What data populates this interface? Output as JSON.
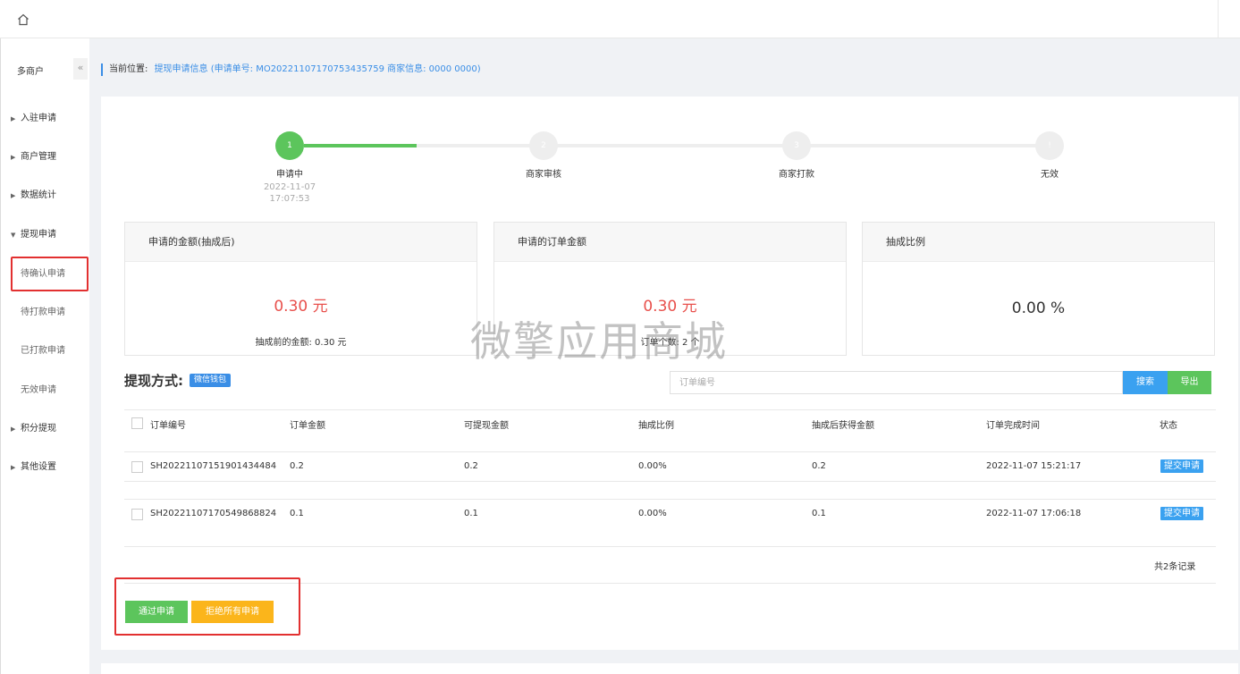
{
  "sidebar": {
    "title": "多商户",
    "collapse_label": "«",
    "items": [
      {
        "label": "入驻申请"
      },
      {
        "label": "商户管理"
      },
      {
        "label": "数据统计"
      },
      {
        "label": "提现申请"
      },
      {
        "label": "积分提现"
      },
      {
        "label": "其他设置"
      }
    ],
    "subitems": [
      {
        "label": "待确认申请",
        "active": true
      },
      {
        "label": "待打款申请"
      },
      {
        "label": "已打款申请"
      },
      {
        "label": "无效申请"
      }
    ]
  },
  "breadcrumb": {
    "label": "当前位置:",
    "text": "提现申请信息 (申请单号: MO20221107170753435759 商家信息: 0000 0000)"
  },
  "steps": [
    {
      "num": "1",
      "label": "申请中",
      "date": "2022-11-07",
      "time": "17:07:53",
      "done": true
    },
    {
      "num": "2",
      "label": "商家审核"
    },
    {
      "num": "3",
      "label": "商家打款"
    },
    {
      "num": "!",
      "label": "无效"
    }
  ],
  "cards": [
    {
      "title": "申请的金额(抽成后)",
      "amount": "0.30 元",
      "foot": "抽成前的金额: 0.30 元"
    },
    {
      "title": "申请的订单金额",
      "amount": "0.30 元",
      "foot": "订单个数: 2 个"
    },
    {
      "title": "抽成比例",
      "amount": "0.00 %"
    }
  ],
  "watermark": "微擎应用商城",
  "method": {
    "label": "提现方式:",
    "badge": "微信钱包"
  },
  "search": {
    "placeholder": "订单编号",
    "search_label": "搜索",
    "export_label": "导出"
  },
  "table": {
    "headers": [
      "订单编号",
      "订单金额",
      "可提现金额",
      "抽成比例",
      "抽成后获得金额",
      "订单完成时间",
      "状态"
    ],
    "rows": [
      {
        "order_no": "SH20221107151901434484",
        "amount": "0.2",
        "withdrawable": "0.2",
        "rate": "0.00%",
        "after": "0.2",
        "time": "2022-11-07 15:21:17",
        "status": "提交申请"
      },
      {
        "order_no": "SH20221107170549868824",
        "amount": "0.1",
        "withdrawable": "0.1",
        "rate": "0.00%",
        "after": "0.1",
        "time": "2022-11-07 17:06:18",
        "status": "提交申请"
      }
    ],
    "total": "共2条记录"
  },
  "actions": {
    "pass_label": "通过申请",
    "reject_label": "拒绝所有申请"
  },
  "colors": {
    "primary": "#3a8ee6",
    "success": "#5cc55c",
    "warning": "#fbb51b",
    "danger": "#e8504c"
  }
}
